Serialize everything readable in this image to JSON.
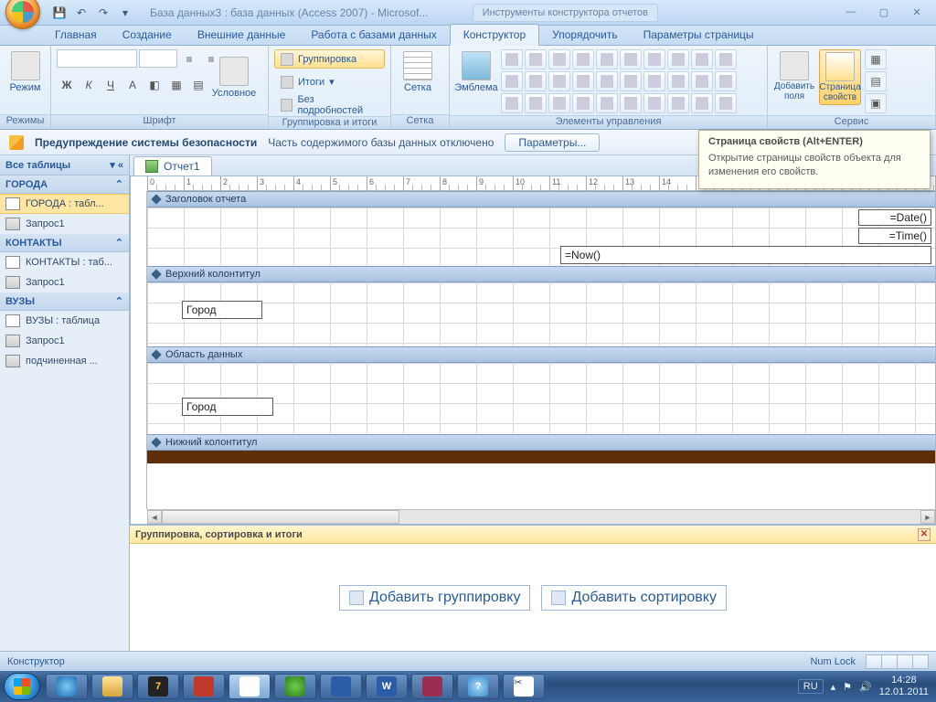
{
  "titlebar": {
    "title": "База данных3 : база данных (Access 2007) - Microsof...",
    "contextual": "Инструменты конструктора отчетов"
  },
  "ribbon_tabs": [
    "Главная",
    "Создание",
    "Внешние данные",
    "Работа с базами данных",
    "Конструктор",
    "Упорядочить",
    "Параметры страницы"
  ],
  "active_tab": "Конструктор",
  "ribbon": {
    "modes": {
      "label": "Режим",
      "caption": "Режимы"
    },
    "font": {
      "caption": "Шрифт",
      "family": ""
    },
    "groupsort": {
      "caption": "Группировка и итоги",
      "grouping": "Группировка",
      "totals": "Итоги",
      "nodetails": "Без подробностей"
    },
    "grid": {
      "caption": "Сетка",
      "label": "Сетка"
    },
    "controls": {
      "caption": "Элементы управления",
      "emblem": "Эмблема"
    },
    "tools": {
      "caption": "Сервис",
      "addfields": "Добавить поля",
      "propsheet": "Страница свойств"
    }
  },
  "security": {
    "heading": "Предупреждение системы безопасности",
    "msg": "Часть содержимого базы данных отключено",
    "btn": "Параметры..."
  },
  "tooltip": {
    "title": "Страница свойств (Alt+ENTER)",
    "body": "Открытие страницы свойств объекта для изменения его свойств."
  },
  "nav": {
    "header": "Все таблицы",
    "groups": [
      {
        "name": "ГОРОДА",
        "items": [
          {
            "label": "ГОРОДА : табл...",
            "type": "table",
            "sel": true
          },
          {
            "label": "Запрос1",
            "type": "query"
          }
        ]
      },
      {
        "name": "КОНТАКТЫ",
        "items": [
          {
            "label": "КОНТАКТЫ : таб...",
            "type": "table"
          },
          {
            "label": "Запрос1",
            "type": "query"
          }
        ]
      },
      {
        "name": "ВУЗЫ",
        "items": [
          {
            "label": "ВУЗЫ : таблица",
            "type": "table"
          },
          {
            "label": "Запрос1",
            "type": "query"
          },
          {
            "label": "подчиненная ...",
            "type": "query"
          }
        ]
      }
    ]
  },
  "doc": {
    "tab": "Отчет1",
    "bands": {
      "report_header": "Заголовок отчета",
      "page_header": "Верхний колонтитул",
      "detail": "Область данных",
      "page_footer": "Нижний колонтитул"
    },
    "controls": {
      "date": "=Date()",
      "time": "=Time()",
      "now": "=Now()",
      "city": "Город"
    }
  },
  "gsort": {
    "title": "Группировка, сортировка и итоги",
    "add_group": "Добавить группировку",
    "add_sort": "Добавить сортировку"
  },
  "status": {
    "mode": "Конструктор",
    "numlock": "Num Lock"
  },
  "taskbar": {
    "lang": "RU",
    "time": "14:28",
    "date": "12.01.2011"
  }
}
